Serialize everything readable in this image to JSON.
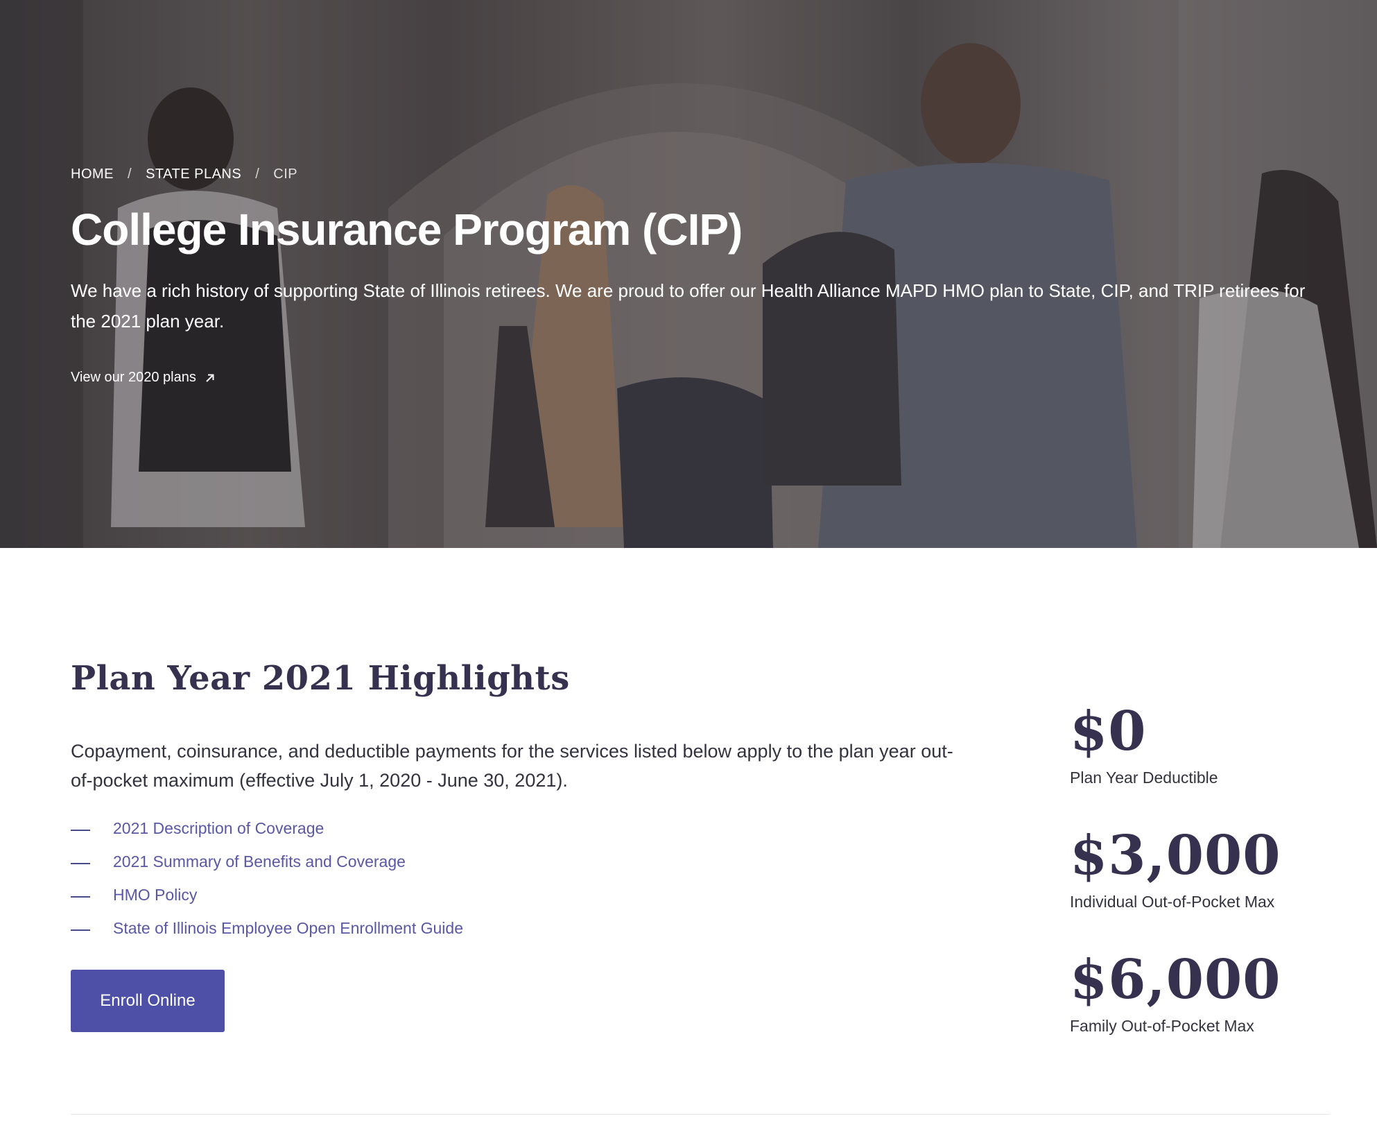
{
  "breadcrumb": {
    "home": "HOME",
    "separator": "/",
    "state_plans": "STATE PLANS",
    "current": "CIP"
  },
  "hero": {
    "title": "College Insurance Program (CIP)",
    "description": "We have a rich history of supporting State of Illinois retirees. We are proud to offer our Health Alliance MAPD HMO plan to State, CIP, and TRIP retirees for the 2021 plan year.",
    "link_label": "View our 2020 plans",
    "link_icon": "arrow-up-right-icon"
  },
  "highlights": {
    "title": "Plan Year 2021 Highlights",
    "description": "Copayment, coinsurance, and deductible payments for the services listed below apply to the plan year out-of-pocket maximum (effective July 1, 2020 - June 30, 2021).",
    "documents": [
      {
        "label": "2021 Description of Coverage"
      },
      {
        "label": "2021 Summary of Benefits and Coverage"
      },
      {
        "label": "HMO Policy"
      },
      {
        "label": "State of Illinois Employee Open Enrollment Guide"
      }
    ],
    "enroll_label": "Enroll Online"
  },
  "stats": [
    {
      "value": "$0",
      "label": "Plan Year Deductible"
    },
    {
      "value": "$3,000",
      "label": "Individual Out-of-Pocket Max"
    },
    {
      "value": "$6,000",
      "label": "Family Out-of-Pocket Max"
    }
  ],
  "colors": {
    "accent": "#4e4fa6",
    "link": "#5a57a6",
    "heading": "#35314f"
  }
}
